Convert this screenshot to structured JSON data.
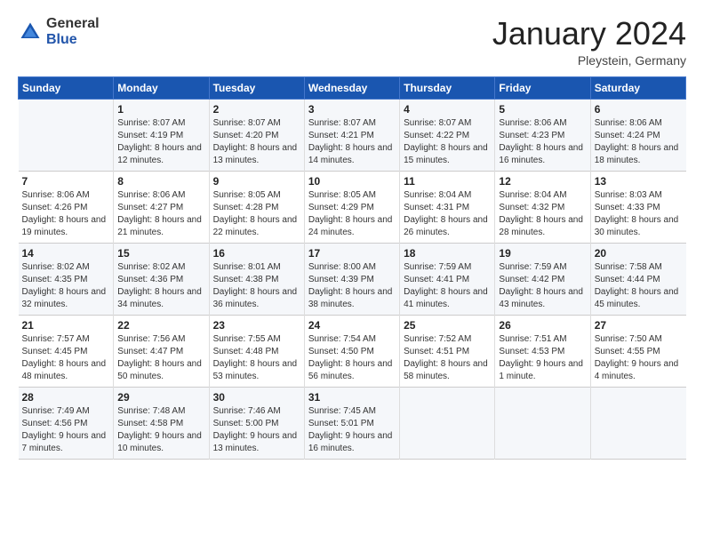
{
  "logo": {
    "general": "General",
    "blue": "Blue"
  },
  "header": {
    "month": "January 2024",
    "location": "Pleystein, Germany"
  },
  "weekdays": [
    "Sunday",
    "Monday",
    "Tuesday",
    "Wednesday",
    "Thursday",
    "Friday",
    "Saturday"
  ],
  "weeks": [
    [
      {
        "day": "",
        "sunrise": "",
        "sunset": "",
        "daylight": ""
      },
      {
        "day": "1",
        "sunrise": "Sunrise: 8:07 AM",
        "sunset": "Sunset: 4:19 PM",
        "daylight": "Daylight: 8 hours and 12 minutes."
      },
      {
        "day": "2",
        "sunrise": "Sunrise: 8:07 AM",
        "sunset": "Sunset: 4:20 PM",
        "daylight": "Daylight: 8 hours and 13 minutes."
      },
      {
        "day": "3",
        "sunrise": "Sunrise: 8:07 AM",
        "sunset": "Sunset: 4:21 PM",
        "daylight": "Daylight: 8 hours and 14 minutes."
      },
      {
        "day": "4",
        "sunrise": "Sunrise: 8:07 AM",
        "sunset": "Sunset: 4:22 PM",
        "daylight": "Daylight: 8 hours and 15 minutes."
      },
      {
        "day": "5",
        "sunrise": "Sunrise: 8:06 AM",
        "sunset": "Sunset: 4:23 PM",
        "daylight": "Daylight: 8 hours and 16 minutes."
      },
      {
        "day": "6",
        "sunrise": "Sunrise: 8:06 AM",
        "sunset": "Sunset: 4:24 PM",
        "daylight": "Daylight: 8 hours and 18 minutes."
      }
    ],
    [
      {
        "day": "7",
        "sunrise": "Sunrise: 8:06 AM",
        "sunset": "Sunset: 4:26 PM",
        "daylight": "Daylight: 8 hours and 19 minutes."
      },
      {
        "day": "8",
        "sunrise": "Sunrise: 8:06 AM",
        "sunset": "Sunset: 4:27 PM",
        "daylight": "Daylight: 8 hours and 21 minutes."
      },
      {
        "day": "9",
        "sunrise": "Sunrise: 8:05 AM",
        "sunset": "Sunset: 4:28 PM",
        "daylight": "Daylight: 8 hours and 22 minutes."
      },
      {
        "day": "10",
        "sunrise": "Sunrise: 8:05 AM",
        "sunset": "Sunset: 4:29 PM",
        "daylight": "Daylight: 8 hours and 24 minutes."
      },
      {
        "day": "11",
        "sunrise": "Sunrise: 8:04 AM",
        "sunset": "Sunset: 4:31 PM",
        "daylight": "Daylight: 8 hours and 26 minutes."
      },
      {
        "day": "12",
        "sunrise": "Sunrise: 8:04 AM",
        "sunset": "Sunset: 4:32 PM",
        "daylight": "Daylight: 8 hours and 28 minutes."
      },
      {
        "day": "13",
        "sunrise": "Sunrise: 8:03 AM",
        "sunset": "Sunset: 4:33 PM",
        "daylight": "Daylight: 8 hours and 30 minutes."
      }
    ],
    [
      {
        "day": "14",
        "sunrise": "Sunrise: 8:02 AM",
        "sunset": "Sunset: 4:35 PM",
        "daylight": "Daylight: 8 hours and 32 minutes."
      },
      {
        "day": "15",
        "sunrise": "Sunrise: 8:02 AM",
        "sunset": "Sunset: 4:36 PM",
        "daylight": "Daylight: 8 hours and 34 minutes."
      },
      {
        "day": "16",
        "sunrise": "Sunrise: 8:01 AM",
        "sunset": "Sunset: 4:38 PM",
        "daylight": "Daylight: 8 hours and 36 minutes."
      },
      {
        "day": "17",
        "sunrise": "Sunrise: 8:00 AM",
        "sunset": "Sunset: 4:39 PM",
        "daylight": "Daylight: 8 hours and 38 minutes."
      },
      {
        "day": "18",
        "sunrise": "Sunrise: 7:59 AM",
        "sunset": "Sunset: 4:41 PM",
        "daylight": "Daylight: 8 hours and 41 minutes."
      },
      {
        "day": "19",
        "sunrise": "Sunrise: 7:59 AM",
        "sunset": "Sunset: 4:42 PM",
        "daylight": "Daylight: 8 hours and 43 minutes."
      },
      {
        "day": "20",
        "sunrise": "Sunrise: 7:58 AM",
        "sunset": "Sunset: 4:44 PM",
        "daylight": "Daylight: 8 hours and 45 minutes."
      }
    ],
    [
      {
        "day": "21",
        "sunrise": "Sunrise: 7:57 AM",
        "sunset": "Sunset: 4:45 PM",
        "daylight": "Daylight: 8 hours and 48 minutes."
      },
      {
        "day": "22",
        "sunrise": "Sunrise: 7:56 AM",
        "sunset": "Sunset: 4:47 PM",
        "daylight": "Daylight: 8 hours and 50 minutes."
      },
      {
        "day": "23",
        "sunrise": "Sunrise: 7:55 AM",
        "sunset": "Sunset: 4:48 PM",
        "daylight": "Daylight: 8 hours and 53 minutes."
      },
      {
        "day": "24",
        "sunrise": "Sunrise: 7:54 AM",
        "sunset": "Sunset: 4:50 PM",
        "daylight": "Daylight: 8 hours and 56 minutes."
      },
      {
        "day": "25",
        "sunrise": "Sunrise: 7:52 AM",
        "sunset": "Sunset: 4:51 PM",
        "daylight": "Daylight: 8 hours and 58 minutes."
      },
      {
        "day": "26",
        "sunrise": "Sunrise: 7:51 AM",
        "sunset": "Sunset: 4:53 PM",
        "daylight": "Daylight: 9 hours and 1 minute."
      },
      {
        "day": "27",
        "sunrise": "Sunrise: 7:50 AM",
        "sunset": "Sunset: 4:55 PM",
        "daylight": "Daylight: 9 hours and 4 minutes."
      }
    ],
    [
      {
        "day": "28",
        "sunrise": "Sunrise: 7:49 AM",
        "sunset": "Sunset: 4:56 PM",
        "daylight": "Daylight: 9 hours and 7 minutes."
      },
      {
        "day": "29",
        "sunrise": "Sunrise: 7:48 AM",
        "sunset": "Sunset: 4:58 PM",
        "daylight": "Daylight: 9 hours and 10 minutes."
      },
      {
        "day": "30",
        "sunrise": "Sunrise: 7:46 AM",
        "sunset": "Sunset: 5:00 PM",
        "daylight": "Daylight: 9 hours and 13 minutes."
      },
      {
        "day": "31",
        "sunrise": "Sunrise: 7:45 AM",
        "sunset": "Sunset: 5:01 PM",
        "daylight": "Daylight: 9 hours and 16 minutes."
      },
      {
        "day": "",
        "sunrise": "",
        "sunset": "",
        "daylight": ""
      },
      {
        "day": "",
        "sunrise": "",
        "sunset": "",
        "daylight": ""
      },
      {
        "day": "",
        "sunrise": "",
        "sunset": "",
        "daylight": ""
      }
    ]
  ]
}
